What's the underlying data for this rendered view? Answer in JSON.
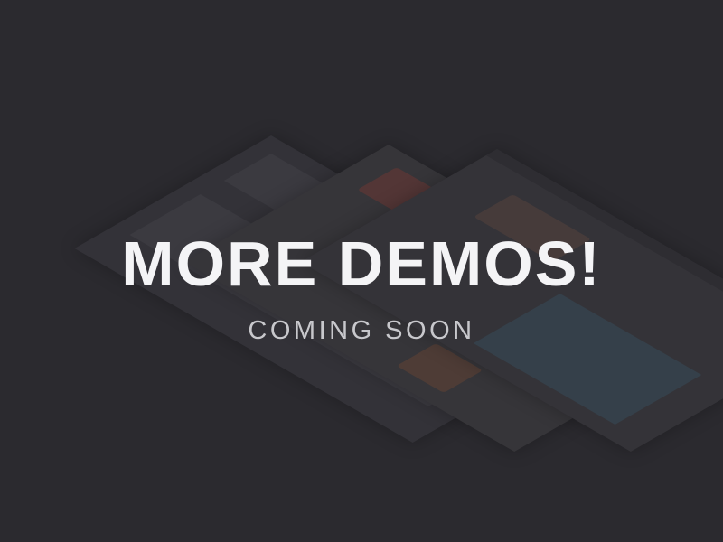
{
  "headline": "MORE DEMOS!",
  "subheadline": "COMING SOON",
  "colors": {
    "background": "#2b2a2f",
    "headline": "#f4f4f6",
    "subheadline": "#c8c8cc"
  }
}
